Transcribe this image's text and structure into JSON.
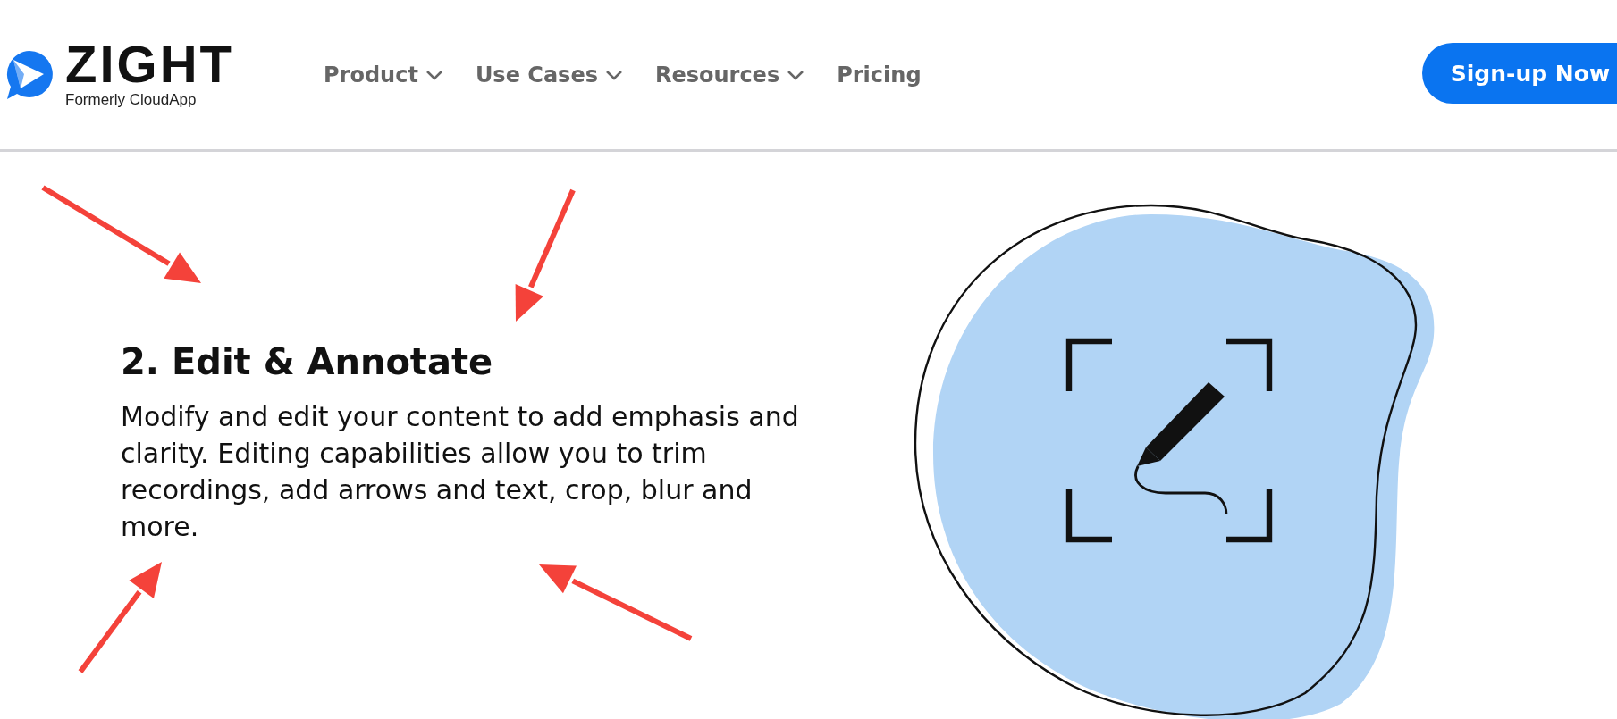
{
  "header": {
    "logo": {
      "wordmark": "ZIGHT",
      "tagline": "Formerly CloudApp"
    },
    "nav": [
      {
        "label": "Product",
        "has_dropdown": true
      },
      {
        "label": "Use Cases",
        "has_dropdown": true
      },
      {
        "label": "Resources",
        "has_dropdown": true
      },
      {
        "label": "Pricing",
        "has_dropdown": false
      }
    ],
    "cta_button": "Sign-up Now"
  },
  "section": {
    "heading": "2. Edit & Annotate",
    "body": "Modify and edit your content to add emphasis and clarity. Editing capabilities allow you to trim recordings, add arrows and text, crop, blur and more."
  }
}
